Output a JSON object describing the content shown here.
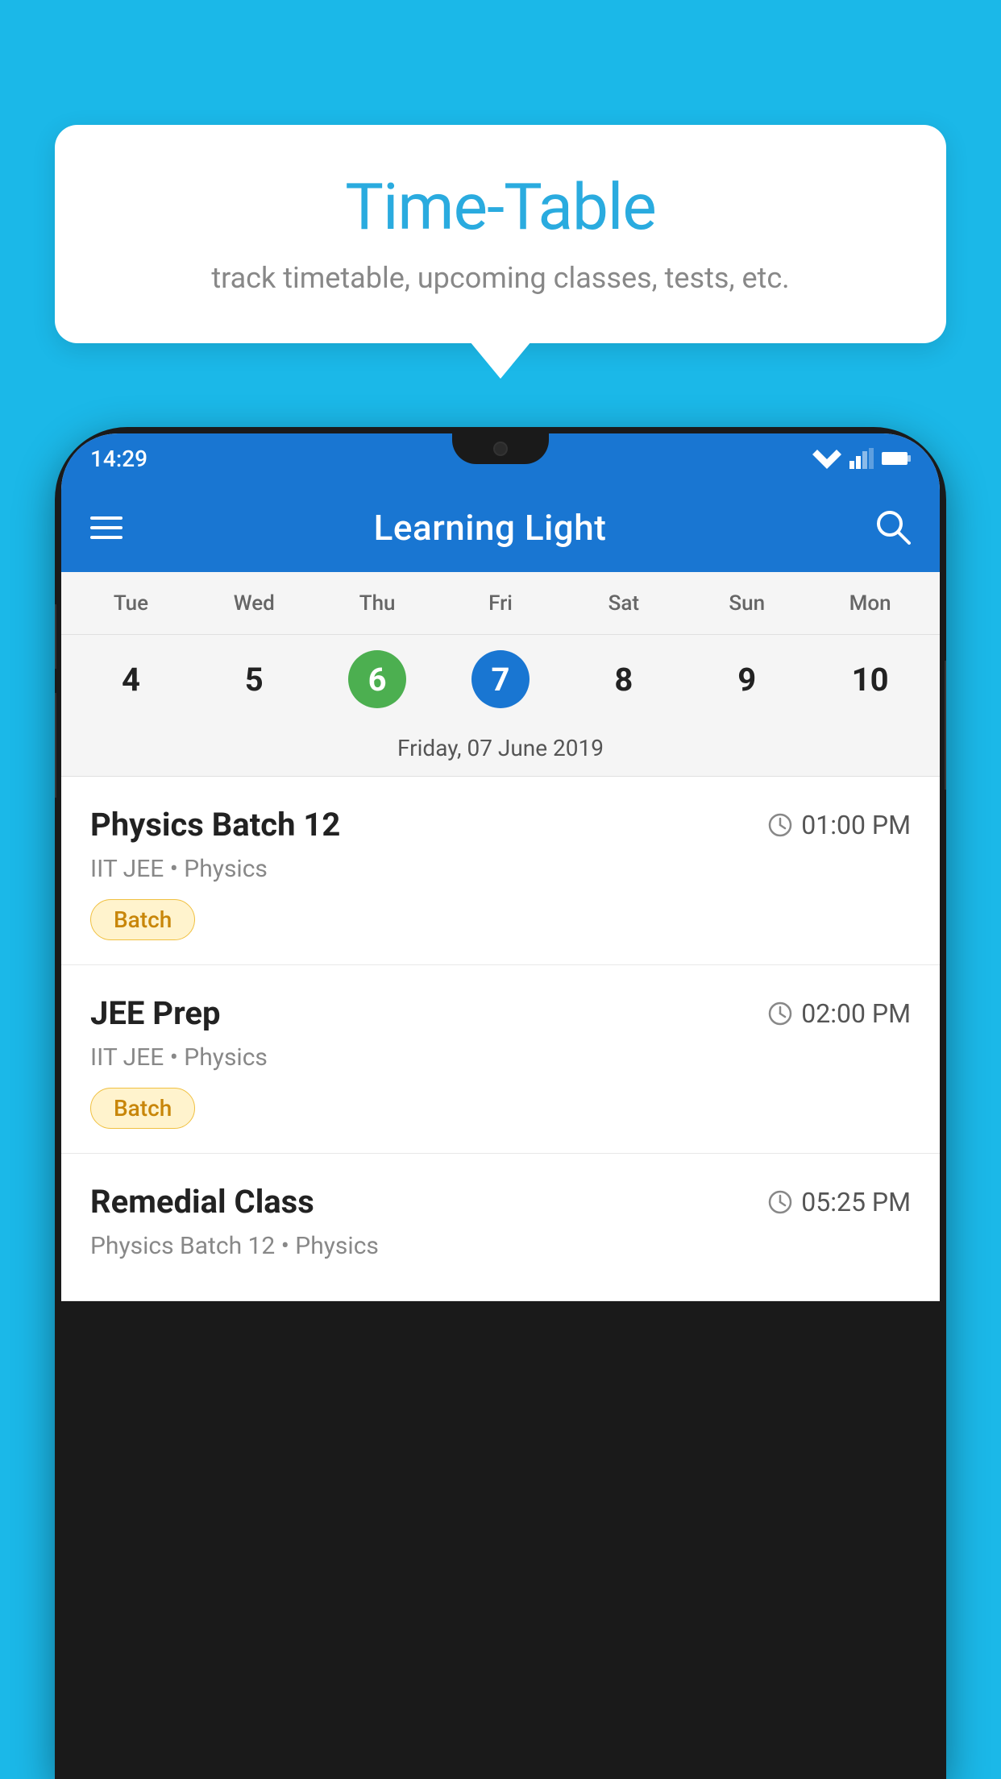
{
  "background_color": "#1BB8E8",
  "tooltip": {
    "title": "Time-Table",
    "subtitle": "track timetable, upcoming classes, tests, etc."
  },
  "phone": {
    "status_bar": {
      "time": "14:29"
    },
    "app_bar": {
      "title": "Learning Light"
    },
    "calendar": {
      "days": [
        "Tue",
        "Wed",
        "Thu",
        "Fri",
        "Sat",
        "Sun",
        "Mon"
      ],
      "dates": [
        "4",
        "5",
        "6",
        "7",
        "8",
        "9",
        "10"
      ],
      "today_index": 2,
      "selected_index": 3,
      "selected_date_label": "Friday, 07 June 2019"
    },
    "schedule_items": [
      {
        "title": "Physics Batch 12",
        "time": "01:00 PM",
        "subtitle": "IIT JEE • Physics",
        "badge": "Batch"
      },
      {
        "title": "JEE Prep",
        "time": "02:00 PM",
        "subtitle": "IIT JEE • Physics",
        "badge": "Batch"
      },
      {
        "title": "Remedial Class",
        "time": "05:25 PM",
        "subtitle": "Physics Batch 12 • Physics",
        "badge": null
      }
    ]
  }
}
